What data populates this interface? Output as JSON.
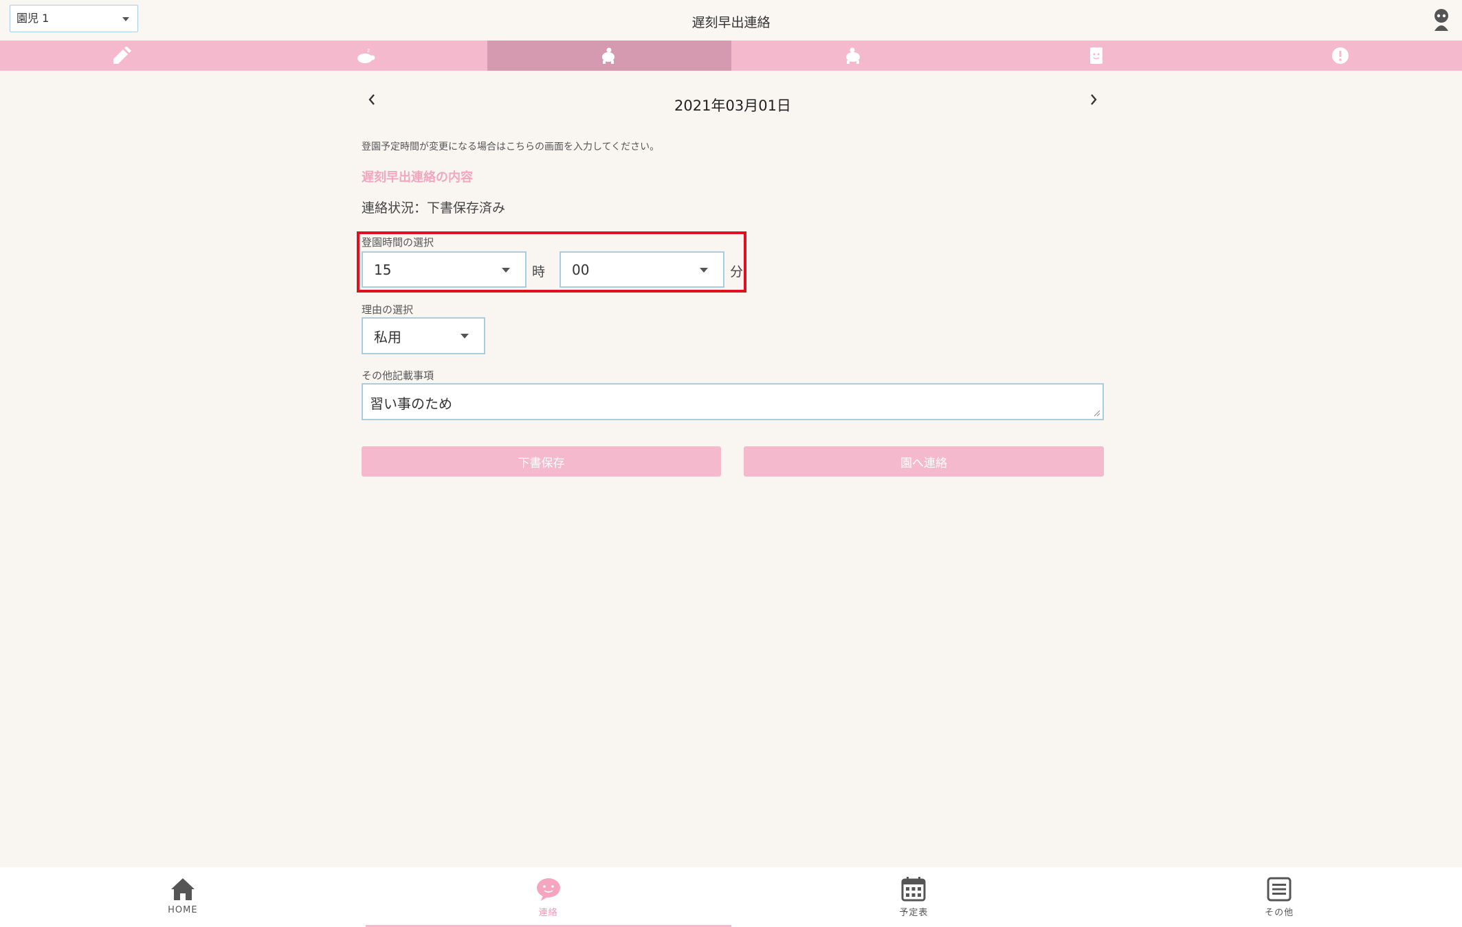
{
  "header": {
    "child_select": "園児 1",
    "title": "遅刻早出連絡"
  },
  "tabs": [
    {
      "icon": "pencil-icon"
    },
    {
      "icon": "sleeping-turtle-icon"
    },
    {
      "icon": "walking-turtle-icon",
      "active": true
    },
    {
      "icon": "turtle-icon"
    },
    {
      "icon": "smiley-card-icon"
    },
    {
      "icon": "alert-bubble-icon"
    }
  ],
  "date_nav": {
    "date": "2021年03月01日"
  },
  "form": {
    "intro": "登園予定時間が変更になる場合はこちらの画面を入力してください。",
    "section_heading": "遅刻早出連絡の内容",
    "status": "連絡状況：下書保存済み",
    "time_label": "登園時間の選択",
    "hour_value": "15",
    "hour_unit": "時",
    "minute_value": "00",
    "minute_unit": "分",
    "reason_label": "理由の選択",
    "reason_value": "私用",
    "notes_label": "その他記載事項",
    "notes_value": "習い事のため",
    "draft_button": "下書保存",
    "send_button": "園へ連絡"
  },
  "bottom_nav": [
    {
      "label": "HOME",
      "icon": "home-icon"
    },
    {
      "label": "連絡",
      "icon": "message-icon",
      "active": true
    },
    {
      "label": "予定表",
      "icon": "calendar-icon"
    },
    {
      "label": "その他",
      "icon": "menu-icon"
    }
  ],
  "colors": {
    "background": "#f9f6f2",
    "tab_bar": "#f4b9cc",
    "tab_active": "#d59aaf",
    "accent_text": "#f2a6bf",
    "field_border": "#a9cde0",
    "highlight": "#e01020"
  }
}
